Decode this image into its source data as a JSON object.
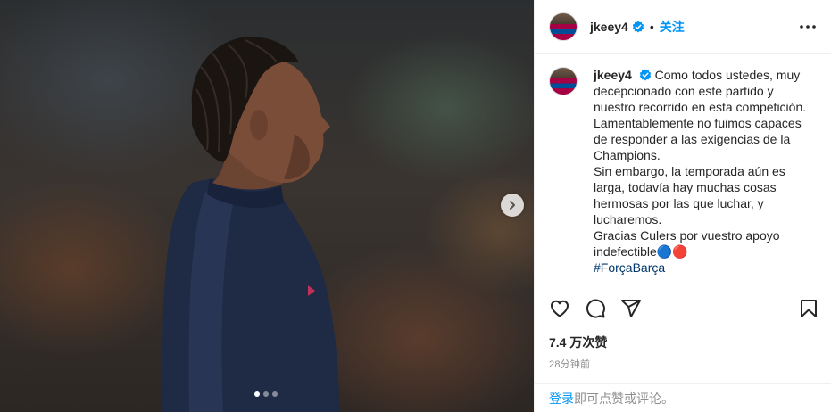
{
  "post": {
    "username": "jkeey4",
    "follow_label": "关注",
    "separator": "•",
    "caption": {
      "username": "jkeey4",
      "lines": [
        "Como todos ustedes, muy decepcionado con este partido y nuestro recorrido en esta competición.",
        "Lamentablemente no fuimos capaces de responder a las exigencias de la Champions.",
        "Sin embargo, la temporada aún es larga, todavía hay muchas cosas hermosas por las que luchar, y lucharemos.",
        "Gracias Culers por vuestro apoyo indefectible🔵🔴"
      ],
      "hashtag": "#ForçaBarça"
    },
    "likes": "7.4 万次赞",
    "time_ago": "28分钟前"
  },
  "login_prompt": {
    "link": "登录",
    "text": "即可点赞或评论。"
  },
  "carousel": {
    "slide_count": 3,
    "active_index": 0
  },
  "icons": {
    "next": "chevron-right-icon",
    "more": "more-horizontal-icon",
    "like": "heart-icon",
    "comment": "comment-icon",
    "share": "share-icon",
    "save": "bookmark-icon",
    "verified": "verified-badge-icon"
  },
  "colors": {
    "accent": "#0095f6",
    "verified": "#0095f6",
    "muted": "#8e8e8e",
    "text": "#262626"
  }
}
